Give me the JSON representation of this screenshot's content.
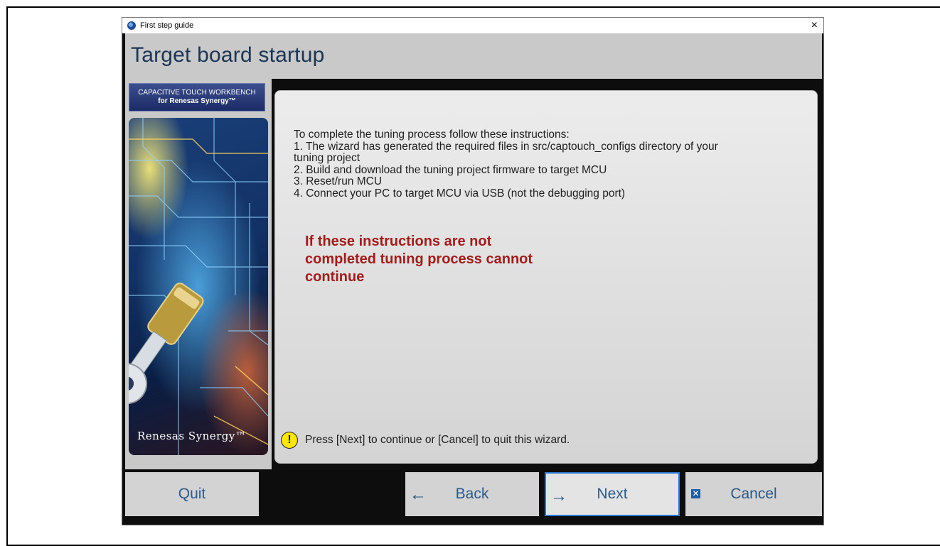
{
  "window": {
    "title": "First step guide",
    "close_glyph": "×"
  },
  "header": {
    "title": "Target board startup"
  },
  "side_panel": {
    "banner_line1": "CAPACITIVE TOUCH WORKBENCH",
    "banner_line2": "for Renesas Synergy™",
    "brand": "Renesas Synergy™"
  },
  "content": {
    "lines": [
      "To complete the tuning process follow these instructions:",
      "1. The wizard has generated the required files in src/captouch_configs directory of your",
      "tuning project",
      "2. Build and download the tuning project firmware to target MCU",
      "3. Reset/run MCU",
      "4. Connect your PC to target MCU via USB (not the debugging port)"
    ],
    "warning_lines": [
      "If these instructions are not",
      "completed tuning process cannot",
      "continue"
    ],
    "hint": "Press [Next] to continue or [Cancel] to quit this wizard.",
    "hint_icon": "warning-exclamation-icon"
  },
  "buttons": {
    "quit": "Quit",
    "back": "Back",
    "next": "Next",
    "cancel": "Cancel"
  },
  "colors": {
    "header_text": "#1b3554",
    "warning_text": "#a21c1c",
    "button_text": "#2a5a8c",
    "next_focus_border": "#2b78d0"
  }
}
